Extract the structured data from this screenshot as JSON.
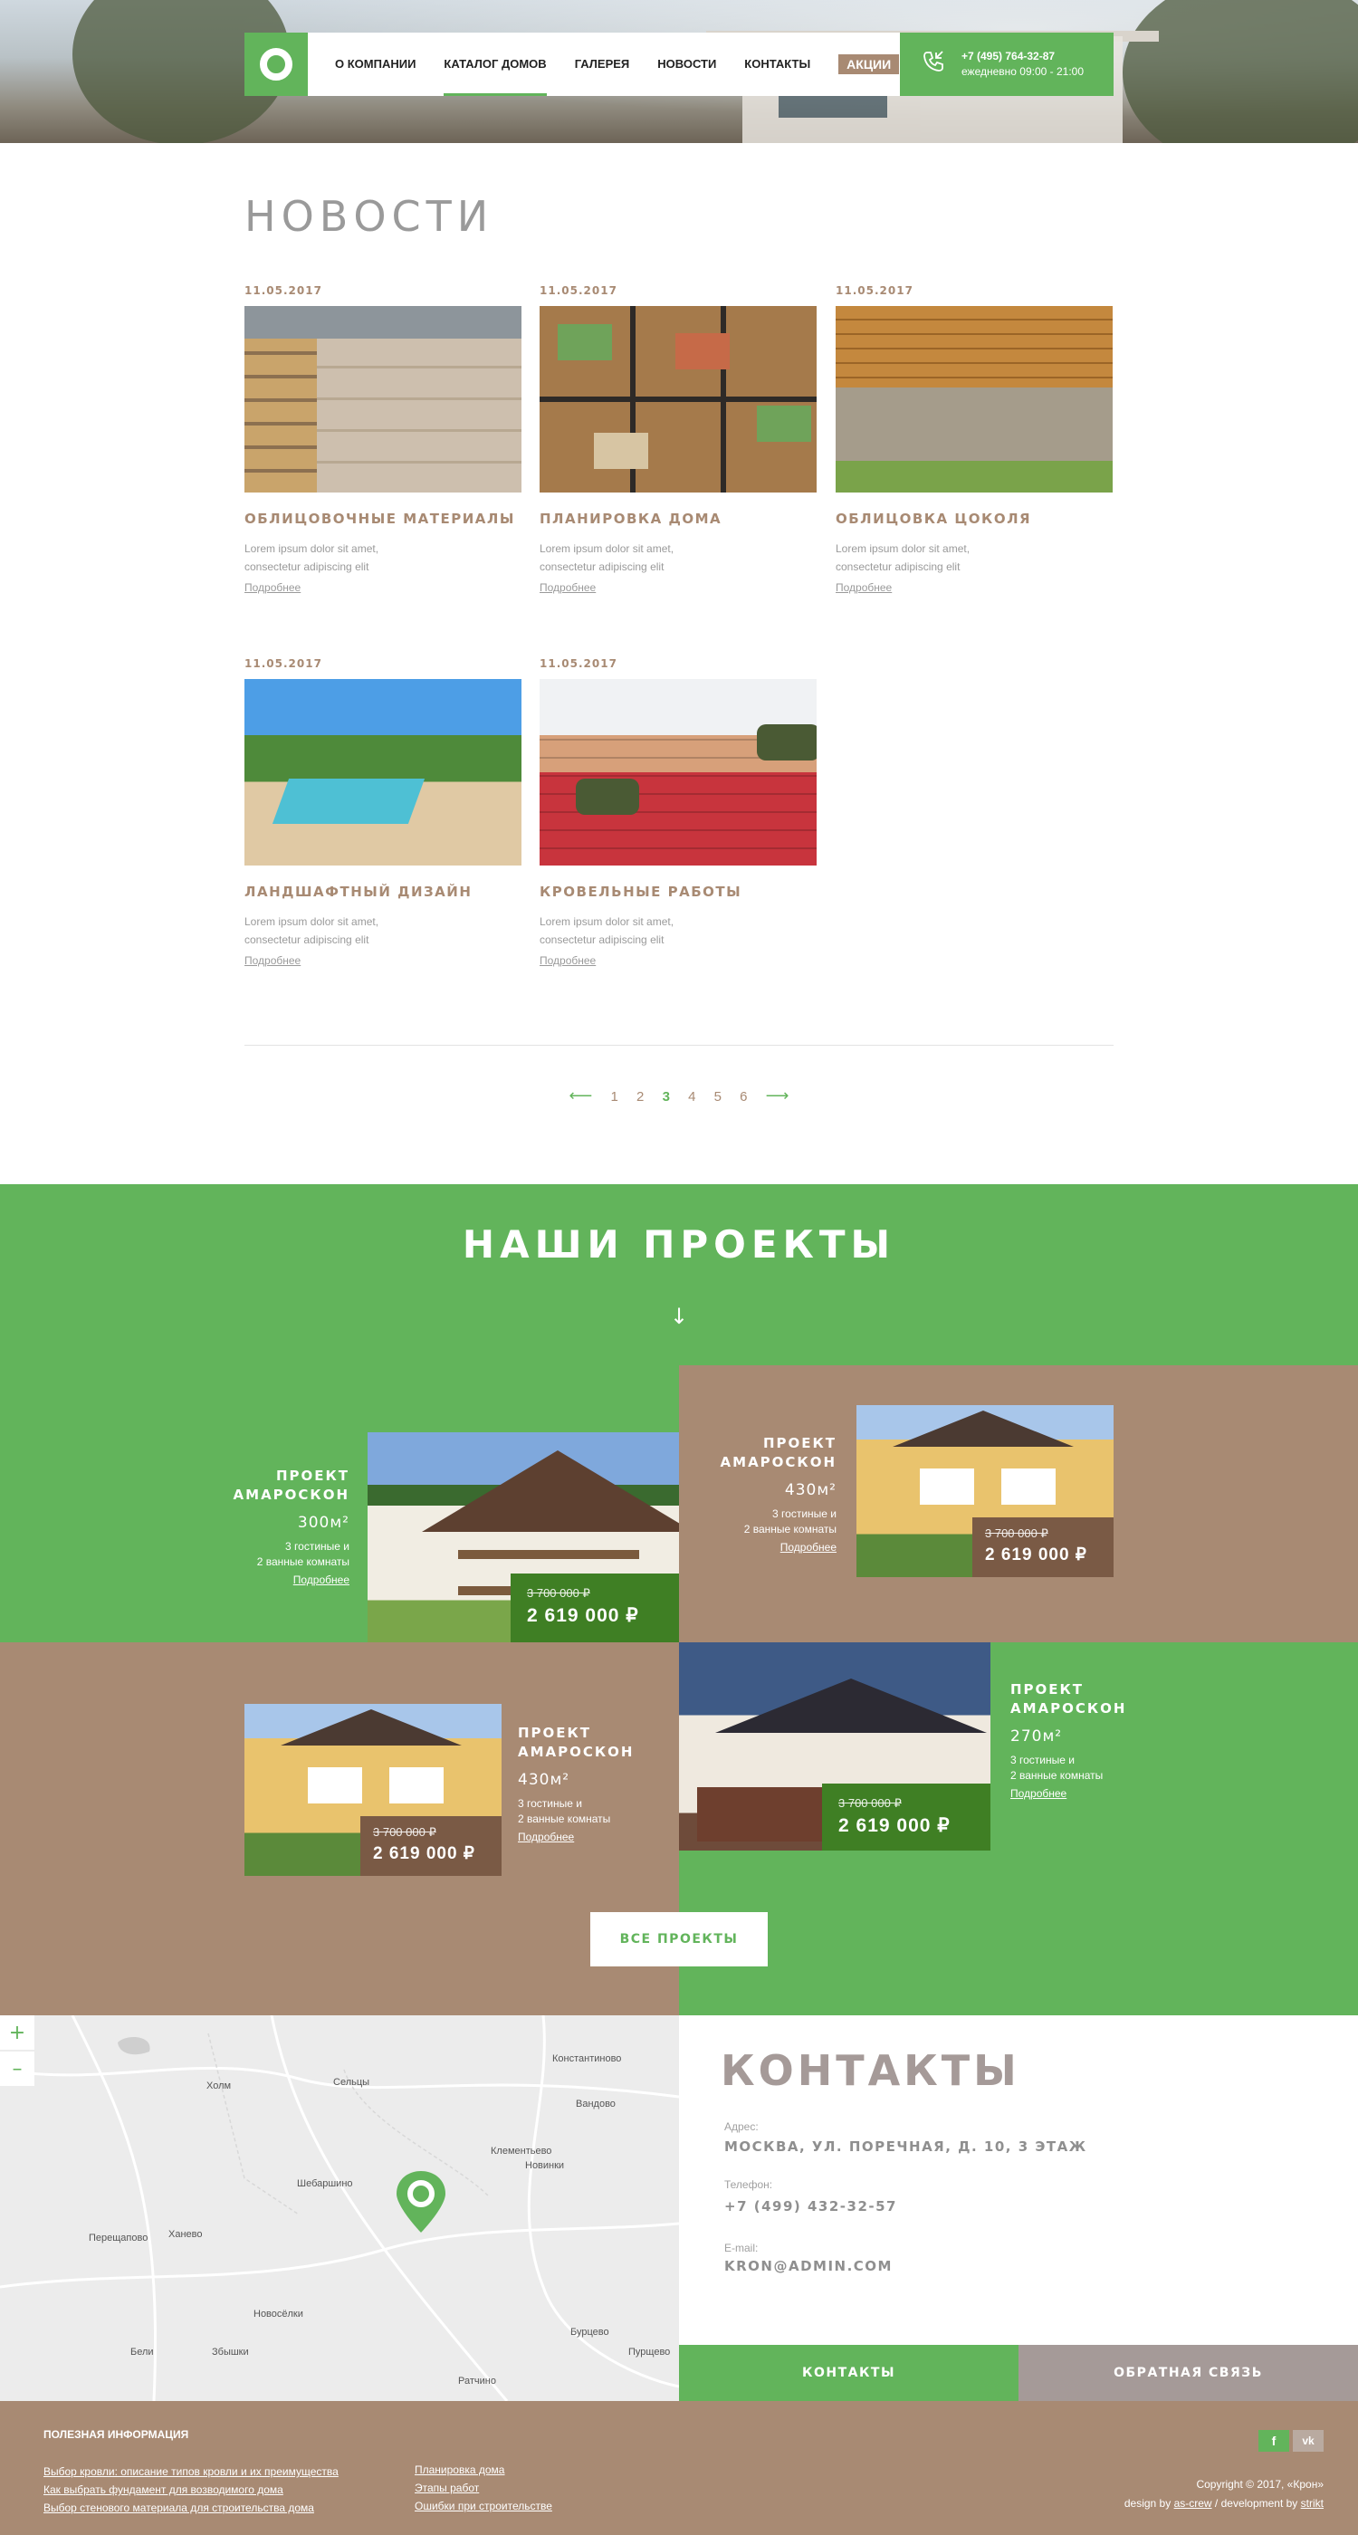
{
  "colors": {
    "green": "#62b45b",
    "brown": "#a88a73",
    "dark_green": "#3f7f24",
    "grey_button": "#a59a98"
  },
  "header": {
    "menu": [
      {
        "label": "О КОМПАНИИ",
        "active": false
      },
      {
        "label": "КАТАЛОГ ДОМОВ",
        "active": true
      },
      {
        "label": "ГАЛЕРЕЯ",
        "active": false
      },
      {
        "label": "НОВОСТИ",
        "active": false
      },
      {
        "label": "КОНТАКТЫ",
        "active": false
      }
    ],
    "promo": "АКЦИИ",
    "phone": "+7 (495) 764-32-87",
    "hours": "ежедневно 09:00 - 21:00",
    "phone_icon": "phone-icon",
    "logo_icon": "ring-logo-icon"
  },
  "news": {
    "title": "НОВОСТИ",
    "items": [
      {
        "date": "11.05.2017",
        "title": "ОБЛИЦОВОЧНЫЕ МАТЕРИАЛЫ",
        "text1": "Lorem ipsum dolor sit amet,",
        "text2": "consectetur adipiscing elit",
        "more": "Подробнее"
      },
      {
        "date": "11.05.2017",
        "title": "ПЛАНИРОВКА ДОМА",
        "text1": "Lorem ipsum dolor sit amet,",
        "text2": "consectetur adipiscing elit",
        "more": "Подробнее"
      },
      {
        "date": "11.05.2017",
        "title": "ОБЛИЦОВКА ЦОКОЛЯ",
        "text1": "Lorem ipsum dolor sit amet,",
        "text2": "consectetur adipiscing elit",
        "more": "Подробнее"
      },
      {
        "date": "11.05.2017",
        "title": "ЛАНДШАФТНЫЙ ДИЗАЙН",
        "text1": "Lorem ipsum dolor sit amet,",
        "text2": "consectetur adipiscing elit",
        "more": "Подробнее"
      },
      {
        "date": "11.05.2017",
        "title": "КРОВЕЛЬНЫЕ РАБОТЫ",
        "text1": "Lorem ipsum dolor sit amet,",
        "text2": "consectetur adipiscing elit",
        "more": "Подробнее"
      }
    ],
    "pagination": {
      "prev": "⟵",
      "next": "⟶",
      "pages": [
        "1",
        "2",
        "3",
        "4",
        "5",
        "6"
      ],
      "current": "3"
    }
  },
  "projects": {
    "title": "НАШИ ПРОЕКТЫ",
    "arrow": "↓",
    "items": [
      {
        "name1": "ПРОЕКТ",
        "name2": "АМАРОСКОН",
        "area": "300м²",
        "desc1": "3 гостиные и",
        "desc2": "2 ванные комнаты",
        "link": "Подробнее",
        "old_price": "3 700 000 ₽",
        "price": "2 619 000 ₽"
      },
      {
        "name1": "ПРОЕКТ",
        "name2": "АМАРОСКОН",
        "area": "430м²",
        "desc1": "3 гостиные и",
        "desc2": "2 ванные комнаты",
        "link": "Подробнее",
        "old_price": "3 700 000 ₽",
        "price": "2 619 000 ₽"
      },
      {
        "name1": "ПРОЕКТ",
        "name2": "АМАРОСКОН",
        "area": "430м²",
        "desc1": "3 гостиные и",
        "desc2": "2 ванные комнаты",
        "link": "Подробнее",
        "old_price": "3 700 000 ₽",
        "price": "2 619 000 ₽"
      },
      {
        "name1": "ПРОЕКТ",
        "name2": "АМАРОСКОН",
        "area": "270м²",
        "desc1": "3 гостиные и",
        "desc2": "2 ванные комнаты",
        "link": "Подробнее",
        "old_price": "3 700 000 ₽",
        "price": "2 619 000 ₽"
      }
    ],
    "all_button": "ВСЕ ПРОЕКТЫ"
  },
  "map": {
    "zoom_in": "+",
    "zoom_out": "–",
    "places": [
      "Константиново",
      "Холм",
      "Сельцы",
      "Вандово",
      "Клементьево",
      "Новинки",
      "Шебаршино",
      "Перещапово",
      "Ханево",
      "Новосёлки",
      "Бели",
      "Збышки",
      "Бурцево",
      "Пурщево",
      "Ратчино"
    ],
    "marker_icon": "map-pin-icon"
  },
  "contacts": {
    "title": "КОНТАКТЫ",
    "address_label": "Адрес:",
    "address": "МОСКВА, УЛ. ПОРЕЧНАЯ, Д. 10, 3 ЭТАЖ",
    "phone_label": "Телефон:",
    "phone": "+7 (499) 432-32-57",
    "email_label": "E-mail:",
    "email": "KRON@ADMIN.COM",
    "btn_contacts": "КОНТАКТЫ",
    "btn_feedback": "ОБРАТНАЯ СВЯЗЬ"
  },
  "footer": {
    "title": "ПОЛЕЗНАЯ ИНФОРМАЦИЯ",
    "links_col1": [
      "Выбор кровли: описание типов кровли и их преимущества",
      "Как выбрать фундамент для возводимого дома",
      "Выбор стенового материала для строительства дома"
    ],
    "links_col2": [
      "Планировка дома",
      "Этапы работ",
      "Ошибки при строительстве"
    ],
    "social": [
      "f",
      "vk"
    ],
    "copyright": "Copyright © 2017, «Крон»",
    "design_prefix": "design by",
    "design_by": "as-crew",
    "dev_prefix": "/ development by",
    "dev_by": "strikt"
  }
}
